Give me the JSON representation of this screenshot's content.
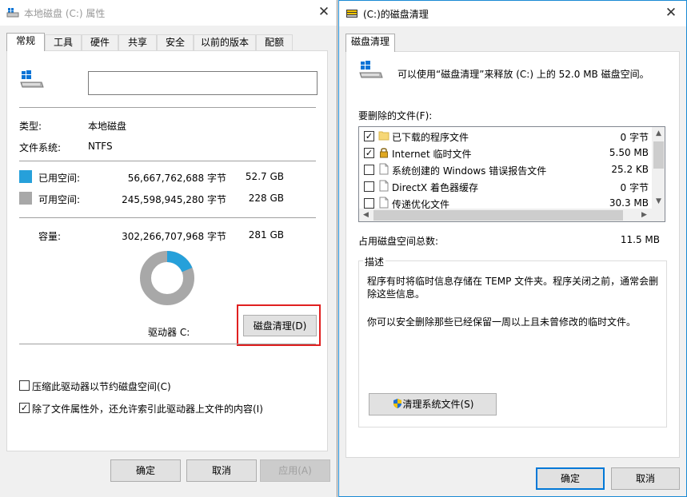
{
  "left_window": {
    "title": "本地磁盘 (C:) 属性",
    "tabs": [
      "常规",
      "工具",
      "硬件",
      "共享",
      "安全",
      "以前的版本",
      "配额"
    ],
    "name_field_value": "",
    "type_label": "类型:",
    "type_value": "本地磁盘",
    "fs_label": "文件系统:",
    "fs_value": "NTFS",
    "used_label": "已用空间:",
    "used_bytes": "56,667,762,688 字节",
    "used_size": "52.7 GB",
    "free_label": "可用空间:",
    "free_bytes": "245,598,945,280 字节",
    "free_size": "228 GB",
    "capacity_label": "容量:",
    "capacity_bytes": "302,266,707,968 字节",
    "capacity_size": "281 GB",
    "drive_label": "驱动器 C:",
    "cleanup_button": "磁盘清理(D)",
    "compress_label": "压缩此驱动器以节约磁盘空间(C)",
    "index_label": "除了文件属性外，还允许索引此驱动器上文件的内容(I)",
    "compress_checked": false,
    "index_checked": true,
    "ok": "确定",
    "cancel": "取消",
    "apply": "应用(A)",
    "used_fraction": 0.187,
    "colors": {
      "used": "#26a0da",
      "free": "#a8a8a8"
    }
  },
  "right_window": {
    "title": "(C:)的磁盘清理",
    "tab": "磁盘清理",
    "intro": "可以使用“磁盘清理”来释放  (C:) 上的 52.0 MB 磁盘空间。",
    "files_label": "要删除的文件(F):",
    "files": [
      {
        "name": "已下载的程序文件",
        "size": "0 字节",
        "checked": true,
        "icon": "folder-icon"
      },
      {
        "name": "Internet 临时文件",
        "size": "5.50 MB",
        "checked": true,
        "icon": "lock-icon"
      },
      {
        "name": "系统创建的 Windows 错误报告文件",
        "size": "25.2 KB",
        "checked": false,
        "icon": "file-icon"
      },
      {
        "name": "DirectX 着色器缓存",
        "size": "0 字节",
        "checked": false,
        "icon": "file-icon"
      },
      {
        "name": "传递优化文件",
        "size": "30.3 MB",
        "checked": false,
        "icon": "file-icon"
      }
    ],
    "total_label": "占用磁盘空间总数:",
    "total_value": "11.5 MB",
    "desc_label": "描述",
    "desc_p1": "程序有时将临时信息存储在 TEMP 文件夹。程序关闭之前，通常会删除这些信息。",
    "desc_p2": "你可以安全删除那些已经保留一周以上且未曾修改的临时文件。",
    "clean_sys_button": "清理系统文件(S)",
    "ok": "确定",
    "cancel": "取消"
  }
}
